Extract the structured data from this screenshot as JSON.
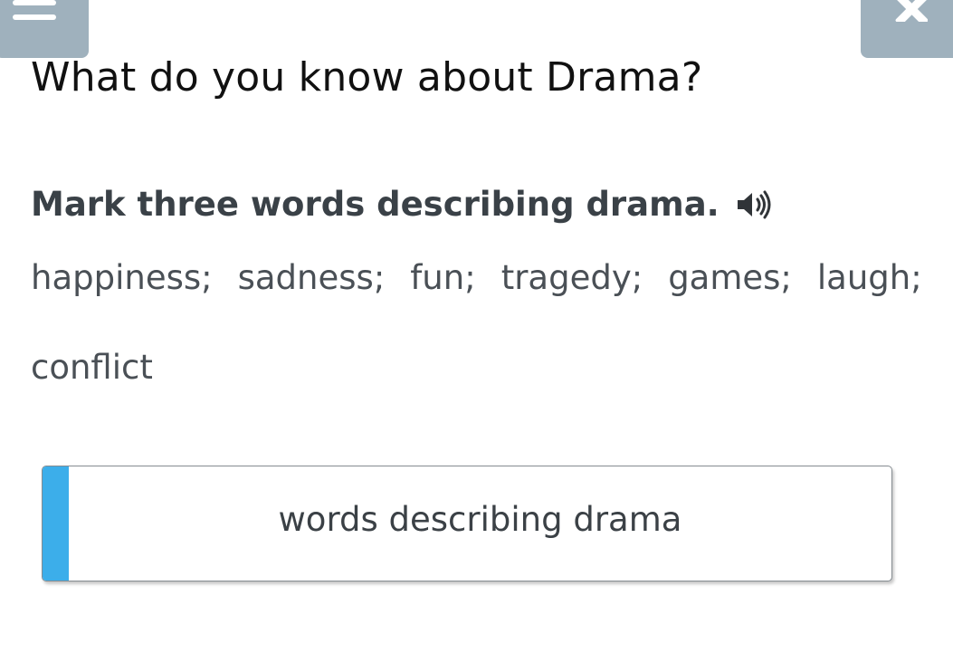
{
  "header": {
    "title": "What do you know about Drama?"
  },
  "task": {
    "instruction": "Mark three words describing drama.",
    "words_line1": [
      "happiness;",
      "sadness;",
      "fun;",
      "tragedy;",
      "games;",
      "laugh;"
    ],
    "words_line2": [
      "conflict"
    ]
  },
  "answer": {
    "label": "words describing drama",
    "accent_color": "#3caeea"
  },
  "controls": {
    "menu_icon": "hamburger-menu-icon",
    "close_icon": "close-icon",
    "audio_icon": "speaker-icon",
    "button_color": "#9fb1bd"
  }
}
